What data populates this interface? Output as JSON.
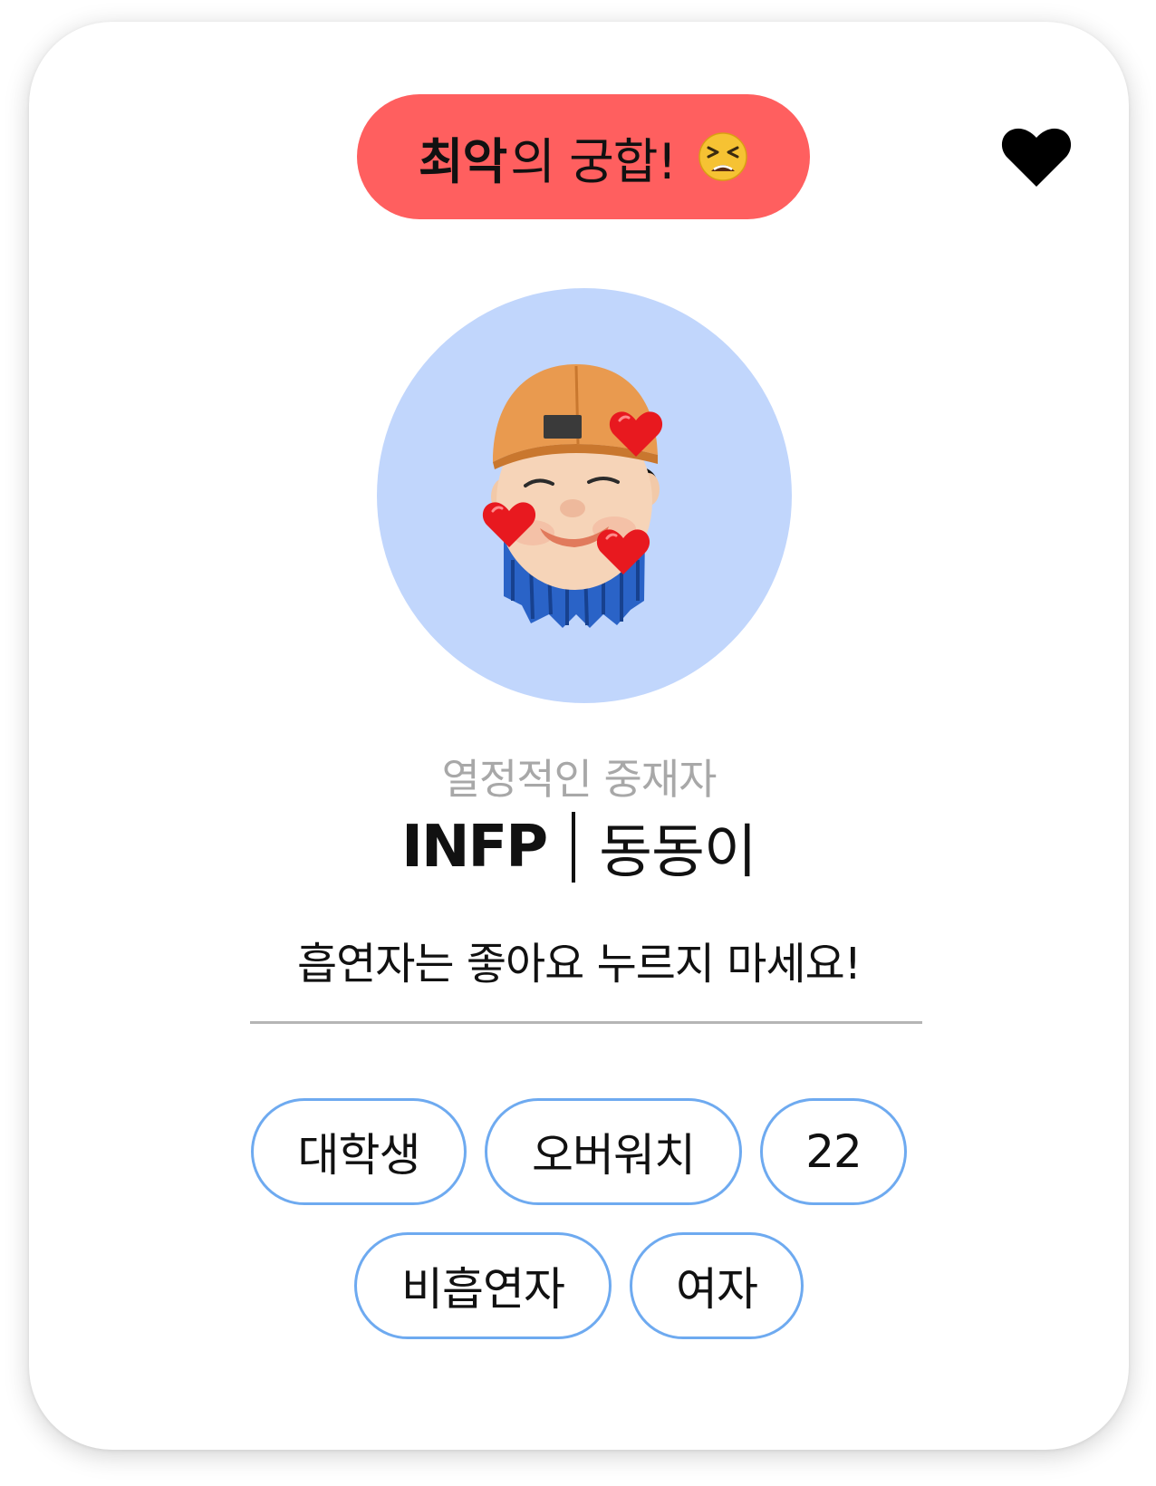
{
  "match_badge": {
    "strong_text": "최악",
    "rest_text": "의 궁합!",
    "emoji_icon": "tired-face-emoji-icon",
    "color": "#ff5f5f"
  },
  "like_button": {
    "icon": "heart-icon",
    "state": "filled"
  },
  "profile": {
    "avatar_icon": "memoji-avatar-with-hearts",
    "avatar_bg_color": "#c1d6fc",
    "subtitle": "열정적인 중재자",
    "mbti": "INFP",
    "nickname": "동동이",
    "bio": "흡연자는 좋아요 누르지 마세요!"
  },
  "tags": {
    "border_color": "#6eaaf0",
    "row1": [
      "대학생",
      "오버워치",
      "22"
    ],
    "row2": [
      "비흡연자",
      "여자"
    ]
  }
}
